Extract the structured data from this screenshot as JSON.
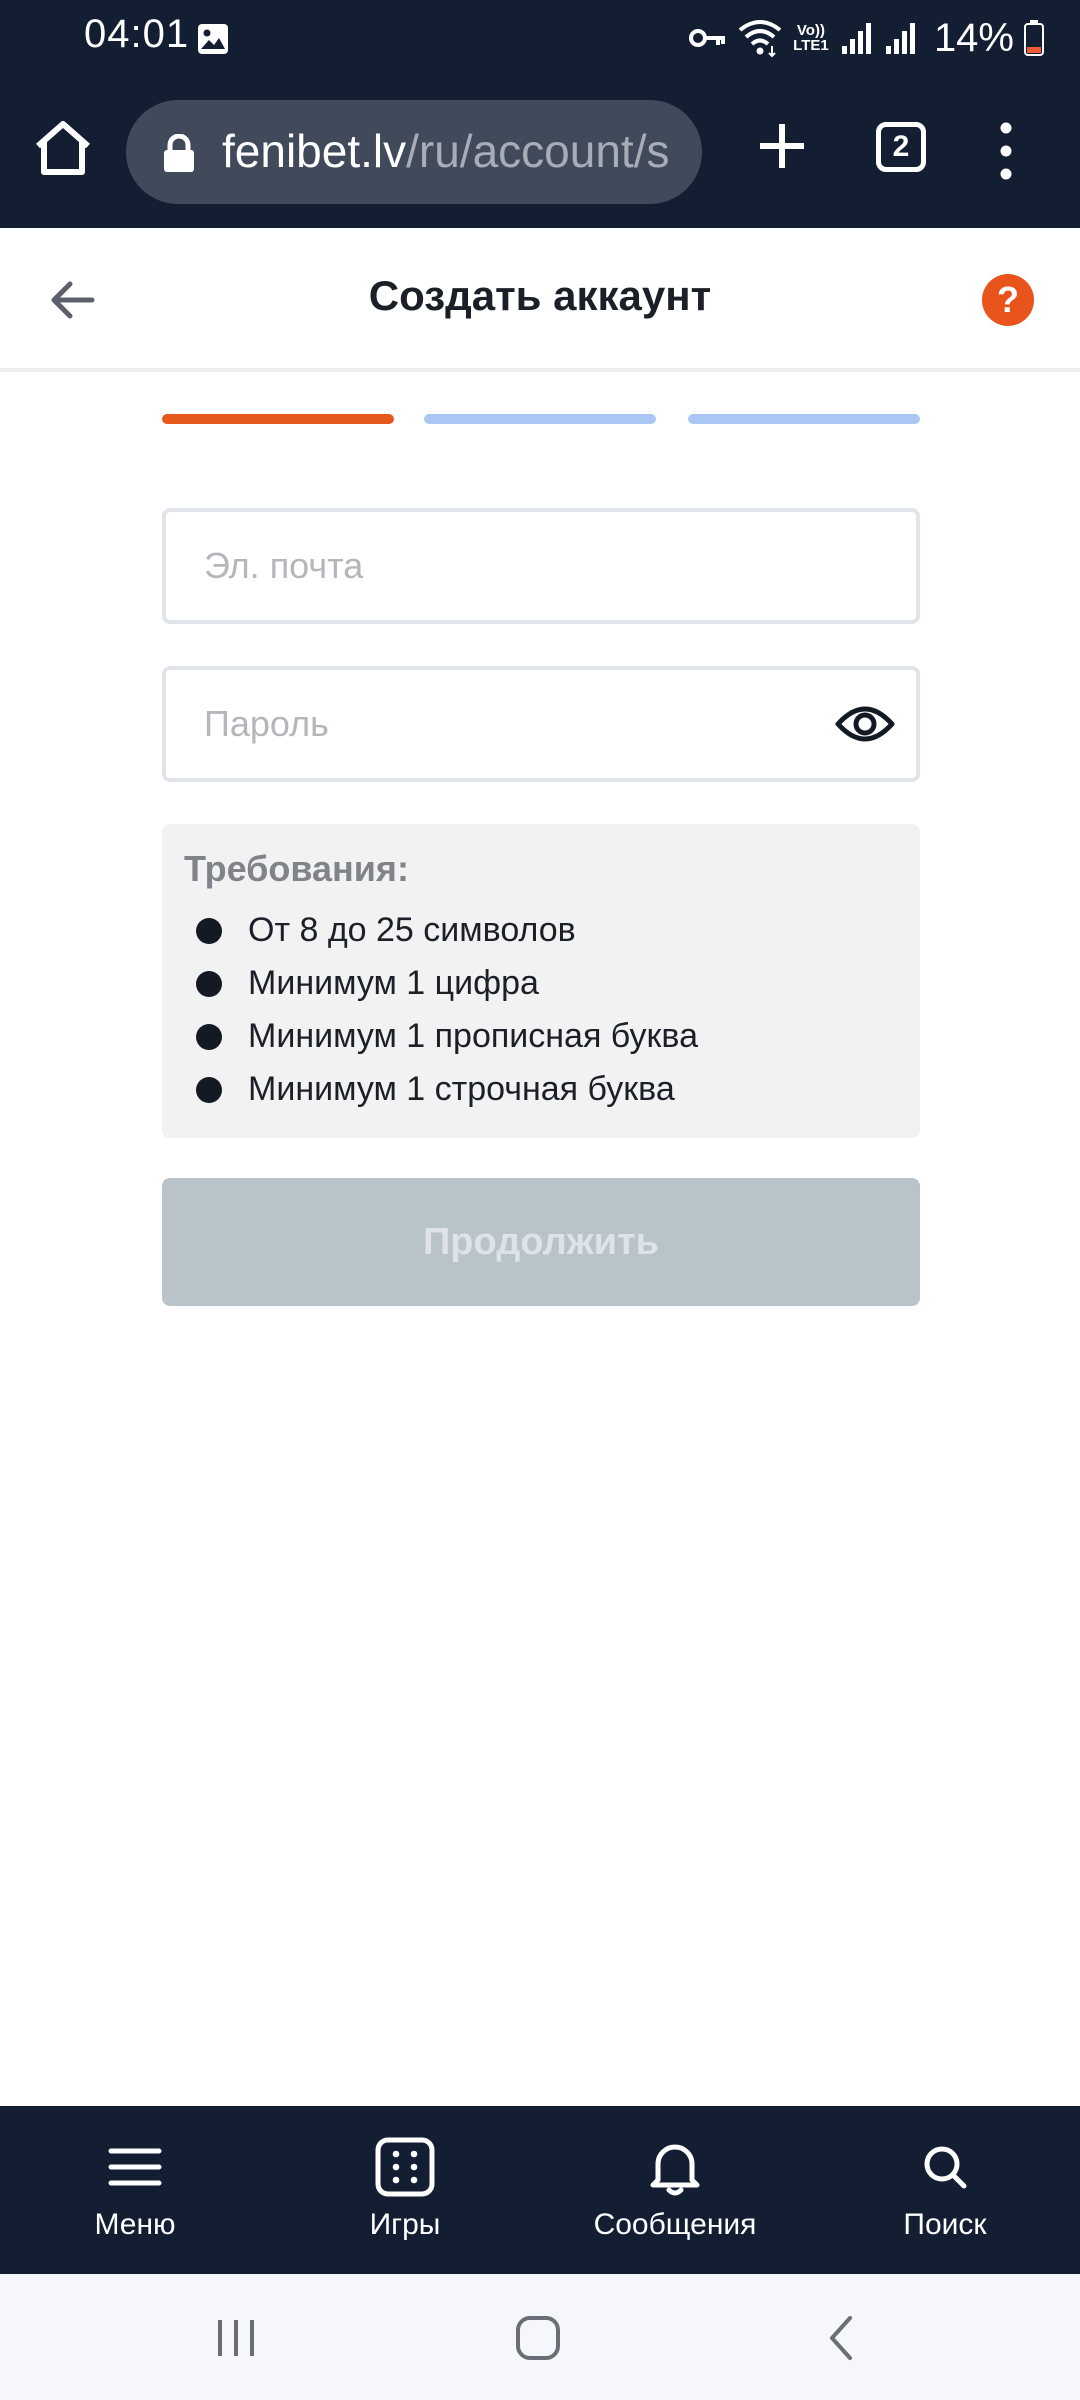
{
  "status_bar": {
    "time": "04:01",
    "volte_label_1": "Vo))",
    "volte_label_2": "LTE1",
    "battery": "14%"
  },
  "browser": {
    "url_domain": "fenibet.lv",
    "url_path": "/ru/account/s",
    "tab_count": "2"
  },
  "header": {
    "title": "Создать аккаунт",
    "help_label": "?"
  },
  "progress": {
    "current_step": 1,
    "total_steps": 3
  },
  "form": {
    "email_placeholder": "Эл. почта",
    "password_placeholder": "Пароль",
    "requirements_title": "Требования:",
    "requirements": [
      "От 8 до 25 символов",
      "Минимум 1 цифра",
      "Минимум 1 прописная буква",
      "Минимум 1 строчная буква"
    ],
    "continue_label": "Продолжить"
  },
  "bottom_nav": {
    "items": [
      {
        "label": "Меню",
        "icon": "menu-icon"
      },
      {
        "label": "Игры",
        "icon": "games-icon"
      },
      {
        "label": "Сообщения",
        "icon": "bell-icon"
      },
      {
        "label": "Поиск",
        "icon": "search-icon"
      }
    ]
  },
  "colors": {
    "dark_bar": "#141e33",
    "accent": "#e8541b",
    "step_inactive": "#a9c6f4",
    "button_disabled": "#b8c3ca"
  }
}
